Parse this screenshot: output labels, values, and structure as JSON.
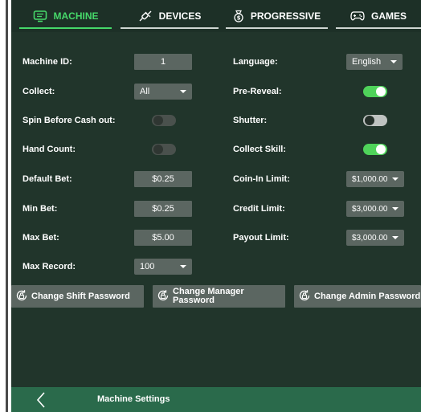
{
  "tabs": [
    {
      "label": "MACHINE",
      "icon": "monitor-icon",
      "active": true
    },
    {
      "label": "DEVICES",
      "icon": "plug-icon",
      "active": false
    },
    {
      "label": "PROGRESSIVE",
      "icon": "coin-bag-icon",
      "active": false
    },
    {
      "label": "GAMES",
      "icon": "gamepad-icon",
      "active": false
    }
  ],
  "left": {
    "machine_id": {
      "label": "Machine ID:",
      "value": "1"
    },
    "collect": {
      "label": "Collect:",
      "value": "All"
    },
    "spin_before_cash_out": {
      "label": "Spin Before Cash out:",
      "on": false
    },
    "hand_count": {
      "label": "Hand Count:",
      "on": false
    },
    "default_bet": {
      "label": "Default Bet:",
      "value": "$0.25"
    },
    "min_bet": {
      "label": "Min Bet:",
      "value": "$0.25"
    },
    "max_bet": {
      "label": "Max Bet:",
      "value": "$5.00"
    },
    "max_record": {
      "label": "Max Record:",
      "value": "100"
    }
  },
  "right": {
    "language": {
      "label": "Language:",
      "value": "English"
    },
    "pre_reveal": {
      "label": "Pre-Reveal:",
      "on": true
    },
    "shutter": {
      "label": "Shutter:",
      "on": false
    },
    "collect_skill": {
      "label": "Collect Skill:",
      "on": true
    },
    "coin_in_limit": {
      "label": "Coin-In Limit:",
      "value": "$1,000.00"
    },
    "credit_limit": {
      "label": "Credit Limit:",
      "value": "$3,000.00"
    },
    "payout_limit": {
      "label": "Payout Limit:",
      "value": "$3,000.00"
    }
  },
  "password_buttons": {
    "shift": "Change Shift Password",
    "manager": "Change Manager Password",
    "admin": "Change Admin Password"
  },
  "footer": {
    "title": "Machine Settings"
  },
  "colors": {
    "accent": "#46d86a",
    "background": "#21352b",
    "footer": "#2a6a4b",
    "field": "#5b6661"
  }
}
